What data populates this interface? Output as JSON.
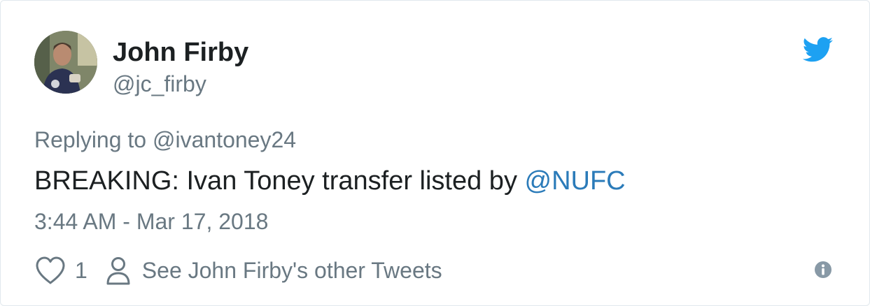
{
  "author": {
    "name": "John Firby",
    "handle": "@jc_firby"
  },
  "reply": {
    "prefix": "Replying to",
    "mention": "@ivantoney24"
  },
  "tweet": {
    "text": "BREAKING: Ivan Toney transfer listed by",
    "link": "@NUFC",
    "timestamp": "3:44 AM - Mar 17, 2018"
  },
  "actions": {
    "like_count": "1",
    "other_tweets_label": "See John Firby's other Tweets"
  },
  "icons": {
    "brand": "twitter-bird-icon",
    "like": "heart-icon",
    "profile": "person-icon",
    "info": "info-icon"
  },
  "colors": {
    "twitter_blue": "#1da1f2",
    "link": "#2b7bb9",
    "text": "#1c2022",
    "secondary": "#697882",
    "border": "#e1e8ed"
  }
}
